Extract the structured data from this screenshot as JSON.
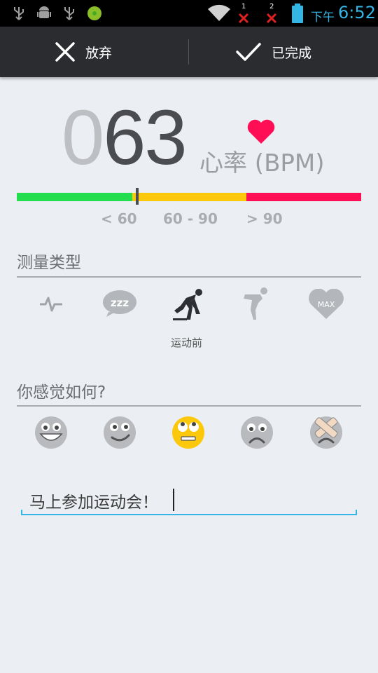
{
  "status_bar": {
    "ampm": "下午",
    "time": "6:52",
    "sim1_label": "1",
    "sim2_label": "2",
    "icons": [
      "usb-icon",
      "android-debug-icon",
      "usb-icon",
      "game-icon",
      "wifi-icon",
      "signal-sim1-icon",
      "signal-sim2-icon",
      "battery-icon"
    ]
  },
  "action_bar": {
    "discard_label": "放弃",
    "done_label": "已完成"
  },
  "reading": {
    "bpm_lead": "0",
    "bpm_rest": "63",
    "unit_label": "心率 (BPM)",
    "heart_color": "#ff0d55"
  },
  "range": {
    "low_label": "< 60",
    "mid_label": "60 - 90",
    "high_label": "> 90",
    "colors": {
      "low": "#22dd4e",
      "mid": "#fbc80c",
      "high": "#ff0d55"
    },
    "min_value": 40,
    "max_value": 130,
    "current_value": 63
  },
  "measure_type": {
    "title": "测量类型",
    "selected_label": "运动前",
    "icons": [
      "pulse-icon",
      "sleep-zzz-icon",
      "runner-start-icon",
      "cooldown-icon",
      "heart-max-icon"
    ],
    "max_text": "MAX",
    "zzz_text": "zzz"
  },
  "feeling": {
    "title": "你感觉如何?",
    "icons": [
      "mood-very-happy-icon",
      "mood-happy-icon",
      "mood-neutral-icon",
      "mood-sad-icon",
      "mood-hurt-icon"
    ],
    "selected_color": "#fbc80c"
  },
  "note": {
    "value": "马上参加运动会！"
  }
}
